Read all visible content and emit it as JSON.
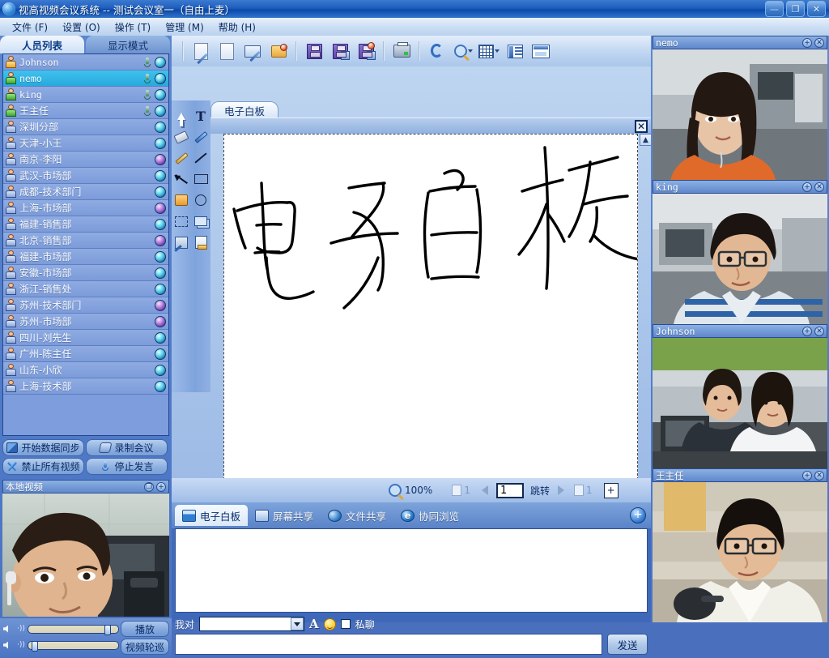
{
  "window": {
    "title": "视高视频会议系统  --  测试会议室一（自由上麦）",
    "app_icon": "globe-icon",
    "minimize": "—",
    "restore": "❐",
    "close": "✕"
  },
  "menubar": [
    {
      "label": "文件 (F)"
    },
    {
      "label": "设置 (O)"
    },
    {
      "label": "操作 (T)"
    },
    {
      "label": "管理 (M)"
    },
    {
      "label": "帮助 (H)"
    }
  ],
  "left_panel": {
    "tabs": [
      {
        "label": "人员列表",
        "active": true
      },
      {
        "label": "显示模式",
        "active": false
      }
    ],
    "participants": [
      {
        "name": "Johnson",
        "mono": true,
        "selected": false,
        "host": true,
        "mic": true,
        "cam": "blue"
      },
      {
        "name": "nemo",
        "mono": true,
        "selected": true,
        "host": false,
        "mic": true,
        "cam": "blue",
        "green": true
      },
      {
        "name": "king",
        "mono": true,
        "selected": false,
        "host": false,
        "mic": true,
        "cam": "blue",
        "green": true
      },
      {
        "name": "王主任",
        "mono": false,
        "selected": false,
        "host": false,
        "mic": true,
        "cam": "blue",
        "green": true
      },
      {
        "name": "深圳分部",
        "mono": false,
        "selected": false,
        "host": false,
        "mic": false,
        "cam": "blue"
      },
      {
        "name": "天津-小王",
        "mono": false,
        "selected": false,
        "host": false,
        "mic": false,
        "cam": "blue"
      },
      {
        "name": "南京-李阳",
        "mono": false,
        "selected": false,
        "host": false,
        "mic": false,
        "cam": "purple"
      },
      {
        "name": "武汉-市场部",
        "mono": false,
        "selected": false,
        "host": false,
        "mic": false,
        "cam": "blue"
      },
      {
        "name": "成都-技术部门",
        "mono": false,
        "selected": false,
        "host": false,
        "mic": false,
        "cam": "blue"
      },
      {
        "name": "上海-市场部",
        "mono": false,
        "selected": false,
        "host": false,
        "mic": false,
        "cam": "purple"
      },
      {
        "name": "福建-销售部",
        "mono": false,
        "selected": false,
        "host": false,
        "mic": false,
        "cam": "blue"
      },
      {
        "name": "北京-销售部",
        "mono": false,
        "selected": false,
        "host": false,
        "mic": false,
        "cam": "purple"
      },
      {
        "name": "福建-市场部",
        "mono": false,
        "selected": false,
        "host": false,
        "mic": false,
        "cam": "blue"
      },
      {
        "name": "安徽-市场部",
        "mono": false,
        "selected": false,
        "host": false,
        "mic": false,
        "cam": "blue"
      },
      {
        "name": "浙江-销售处",
        "mono": false,
        "selected": false,
        "host": false,
        "mic": false,
        "cam": "blue"
      },
      {
        "name": "苏州-技术部门",
        "mono": false,
        "selected": false,
        "host": false,
        "mic": false,
        "cam": "purple"
      },
      {
        "name": "苏州-市场部",
        "mono": false,
        "selected": false,
        "host": false,
        "mic": false,
        "cam": "purple"
      },
      {
        "name": "四川-刘先生",
        "mono": false,
        "selected": false,
        "host": false,
        "mic": false,
        "cam": "blue"
      },
      {
        "name": "广州-陈主任",
        "mono": false,
        "selected": false,
        "host": false,
        "mic": false,
        "cam": "blue"
      },
      {
        "name": "山东-小欣",
        "mono": false,
        "selected": false,
        "host": false,
        "mic": false,
        "cam": "blue"
      },
      {
        "name": "上海-技术部",
        "mono": false,
        "selected": false,
        "host": false,
        "mic": false,
        "cam": "blue"
      }
    ],
    "buttons": [
      {
        "label": "开始数据同步",
        "icon": "sync-icon"
      },
      {
        "label": "录制会议",
        "icon": "record-icon"
      },
      {
        "label": "禁止所有视频",
        "icon": "disable-video-icon"
      },
      {
        "label": "停止发言",
        "icon": "microphone-icon"
      }
    ],
    "local_video": {
      "title": "本地视频",
      "restore_btn": "❐",
      "expand_btn": "+"
    },
    "av_controls": {
      "speaker_icon": "speaker-icon",
      "speaker_value": 92,
      "mic_icon": "microphone-icon",
      "mic_value": 4,
      "play_label": "播放",
      "patrol_label": "视频轮巡"
    }
  },
  "toolbar": {
    "items": [
      {
        "name": "new-whiteboard-icon"
      },
      {
        "name": "new-page-icon"
      },
      {
        "name": "screen-capture-icon"
      },
      {
        "name": "open-file-icon"
      },
      {
        "name": "save-icon"
      },
      {
        "name": "save-as-icon"
      },
      {
        "name": "save-all-icon"
      },
      {
        "name": "print-icon"
      },
      {
        "name": "refresh-icon"
      },
      {
        "name": "zoom-icon"
      },
      {
        "name": "grid-icon"
      },
      {
        "name": "list-view-icon"
      },
      {
        "name": "window-view-icon"
      }
    ]
  },
  "whiteboard": {
    "tab_label": "电子白板",
    "close_label": "✕",
    "canvas_text": "电子白板",
    "tools": [
      {
        "name": "pointer-tool"
      },
      {
        "name": "text-tool"
      },
      {
        "name": "eraser-tool"
      },
      {
        "name": "marker-tool"
      },
      {
        "name": "pencil-tool"
      },
      {
        "name": "line-tool"
      },
      {
        "name": "arrow-tool"
      },
      {
        "name": "rectangle-tool"
      },
      {
        "name": "pointer-hand-tool"
      },
      {
        "name": "ellipse-tool"
      },
      {
        "name": "select-tool"
      },
      {
        "name": "copy-tool"
      },
      {
        "name": "cut-tool"
      },
      {
        "name": "paste-tool"
      }
    ]
  },
  "statusbar": {
    "zoom_icon": "magnifier-icon",
    "zoom_level": "100%",
    "page_prev_label": "1",
    "page_current": "1",
    "jump_label": "跳转",
    "page_next_label": "1",
    "add_page_label": "+"
  },
  "bottom_tabs": [
    {
      "label": "电子白板",
      "icon": "whiteboard-icon",
      "active": true
    },
    {
      "label": "屏幕共享",
      "icon": "screen-share-icon",
      "active": false
    },
    {
      "label": "文件共享",
      "icon": "file-share-icon",
      "active": false
    },
    {
      "label": "协同浏览",
      "icon": "browser-icon",
      "active": false
    }
  ],
  "bottom_tabs_add": "+",
  "chat": {
    "to_label": "我对",
    "target_value": "",
    "target_placeholder": "",
    "font_label": "A",
    "emoji_icon": "smiley-icon",
    "private_label": "私聊",
    "private_checked": false,
    "message_value": "",
    "message_placeholder": "",
    "send_label": "发送"
  },
  "video_panels": [
    {
      "title": "nemo",
      "mono": true,
      "expand": "+",
      "close": "✕"
    },
    {
      "title": "king",
      "mono": true,
      "expand": "+",
      "close": "✕"
    },
    {
      "title": "Johnson",
      "mono": true,
      "expand": "+",
      "close": "✕"
    },
    {
      "title": "王主任",
      "mono": false,
      "expand": "+",
      "close": "✕"
    }
  ],
  "colors": {
    "title_blue": "#0b49ab",
    "accent": "#2f74cb",
    "selection": "#27a9dd",
    "panel_blue": "#5a83c8"
  }
}
